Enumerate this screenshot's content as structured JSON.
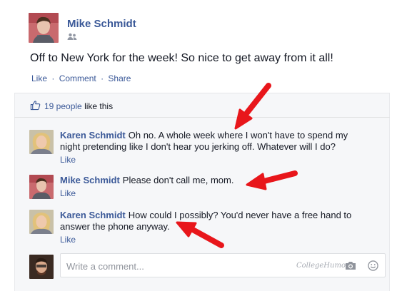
{
  "post": {
    "author": "Mike Schmidt",
    "audience_icon": "friends-icon",
    "text": "Off to New York for the week! So nice to get away from it all!",
    "actions": {
      "like": "Like",
      "comment": "Comment",
      "share": "Share",
      "separator": "·"
    }
  },
  "likes": {
    "count": "19 people",
    "suffix": "like this",
    "icon": "thumbs-up-icon"
  },
  "comments": [
    {
      "author": "Karen Schmidt",
      "text": "Oh no. A whole week where I won't have to spend my night pretending like I don't hear you jerking off. Whatever will I do?",
      "like": "Like"
    },
    {
      "author": "Mike Schmidt",
      "text": "Please don't call me, mom.",
      "like": "Like"
    },
    {
      "author": "Karen Schmidt",
      "text": "How could I possibly? You'd never have a free hand to answer the phone anyway.",
      "like": "Like"
    }
  ],
  "composer": {
    "placeholder": "Write a comment...",
    "watermark": "CollegeHumor",
    "icons": [
      "camera-icon",
      "smiley-icon"
    ]
  },
  "colors": {
    "link": "#3b5998",
    "arrow": "#e8161b",
    "feedback_bg": "#f6f7f9"
  }
}
